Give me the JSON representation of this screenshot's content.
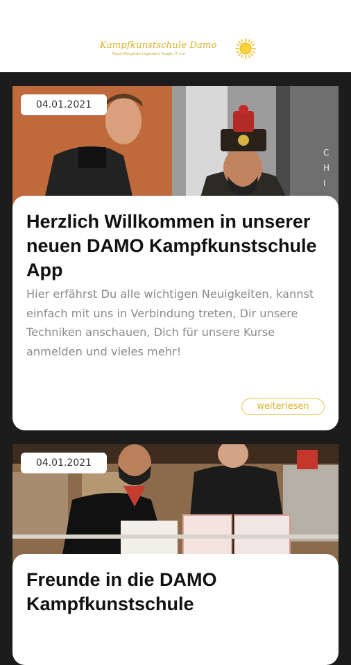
{
  "header": {
    "logo_title": "Kampfkunstschule Damo",
    "logo_subtitle": "Royal Mongolian Legendary Kungfu ® e.V."
  },
  "posts": [
    {
      "date": "04.01.2021",
      "title": "Herzlich Willkommen in unserer neuen DAMO Kampfkunstschule App",
      "text": "Hier erfährst Du alle wichtigen Neuigkeiten, kannst einfach mit uns in Verbindung treten, Dir unsere Techniken anschauen, Dich für unsere Kurse anmelden und vieles mehr!",
      "read_more": "weiterlesen",
      "photo_sign": "CHI"
    },
    {
      "date": "04.01.2021",
      "title": "Freunde in die DAMO Kampfkunstschule"
    }
  ],
  "colors": {
    "accent": "#d8b12e",
    "background": "#1c1c1c"
  }
}
